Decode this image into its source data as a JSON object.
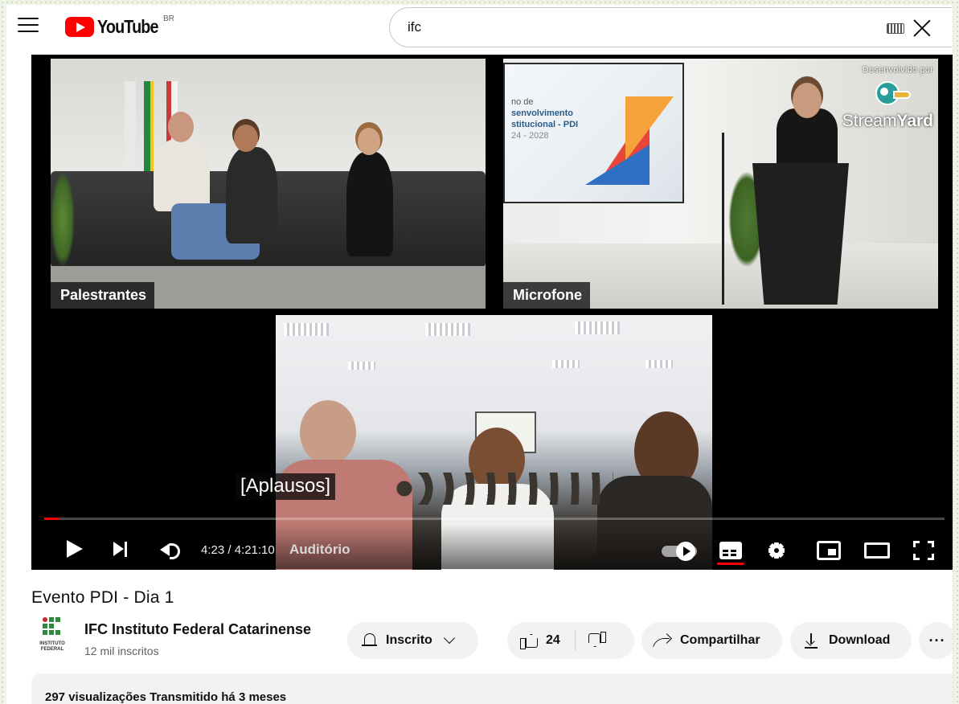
{
  "header": {
    "logo_text": "YouTube",
    "country_code": "BR",
    "search_query": "ifc"
  },
  "player": {
    "feeds": [
      {
        "label": "Palestrantes"
      },
      {
        "label": "Microfone"
      },
      {
        "label": "Auditório"
      }
    ],
    "slide_text_lines": [
      "no de",
      "senvolvimento",
      "stitucional - PDI",
      "24 - 2028"
    ],
    "watermark": {
      "line1": "Desenvolvido por",
      "brand_light": "Stream",
      "brand_bold": "Yard"
    },
    "caption": "[Aplausos]",
    "time": "4:23 / 4:21:10",
    "progress_fraction": 0.017,
    "colors": {
      "progress": "#ff0000",
      "subtitle_active": "#ff0000"
    }
  },
  "video": {
    "title": "Evento PDI - Dia 1",
    "channel": {
      "name": "IFC Instituto Federal Catarinense",
      "subscribers": "12 mil inscritos",
      "avatar_text": "INSTITUTO FEDERAL"
    },
    "subscribe_label": "Inscrito",
    "like_count": "24",
    "share_label": "Compartilhar",
    "download_label": "Download",
    "more_label": "···",
    "description_meta": "297 visualizações  Transmitido há 3 meses"
  },
  "icons": {
    "menu": "menu-icon",
    "keyboard": "keyboard-icon",
    "clear": "clear-icon",
    "play": "play-icon",
    "next": "next-icon",
    "volume": "volume-icon",
    "autoplay": "autoplay-toggle",
    "subtitles": "subtitles-icon",
    "settings": "gear-icon",
    "miniplayer": "miniplayer-icon",
    "theater": "theater-mode-icon",
    "fullscreen": "fullscreen-icon",
    "bell": "bell-icon",
    "thumb_up": "thumb-up-icon",
    "thumb_down": "thumb-down-icon",
    "share": "share-icon",
    "download": "download-icon"
  }
}
